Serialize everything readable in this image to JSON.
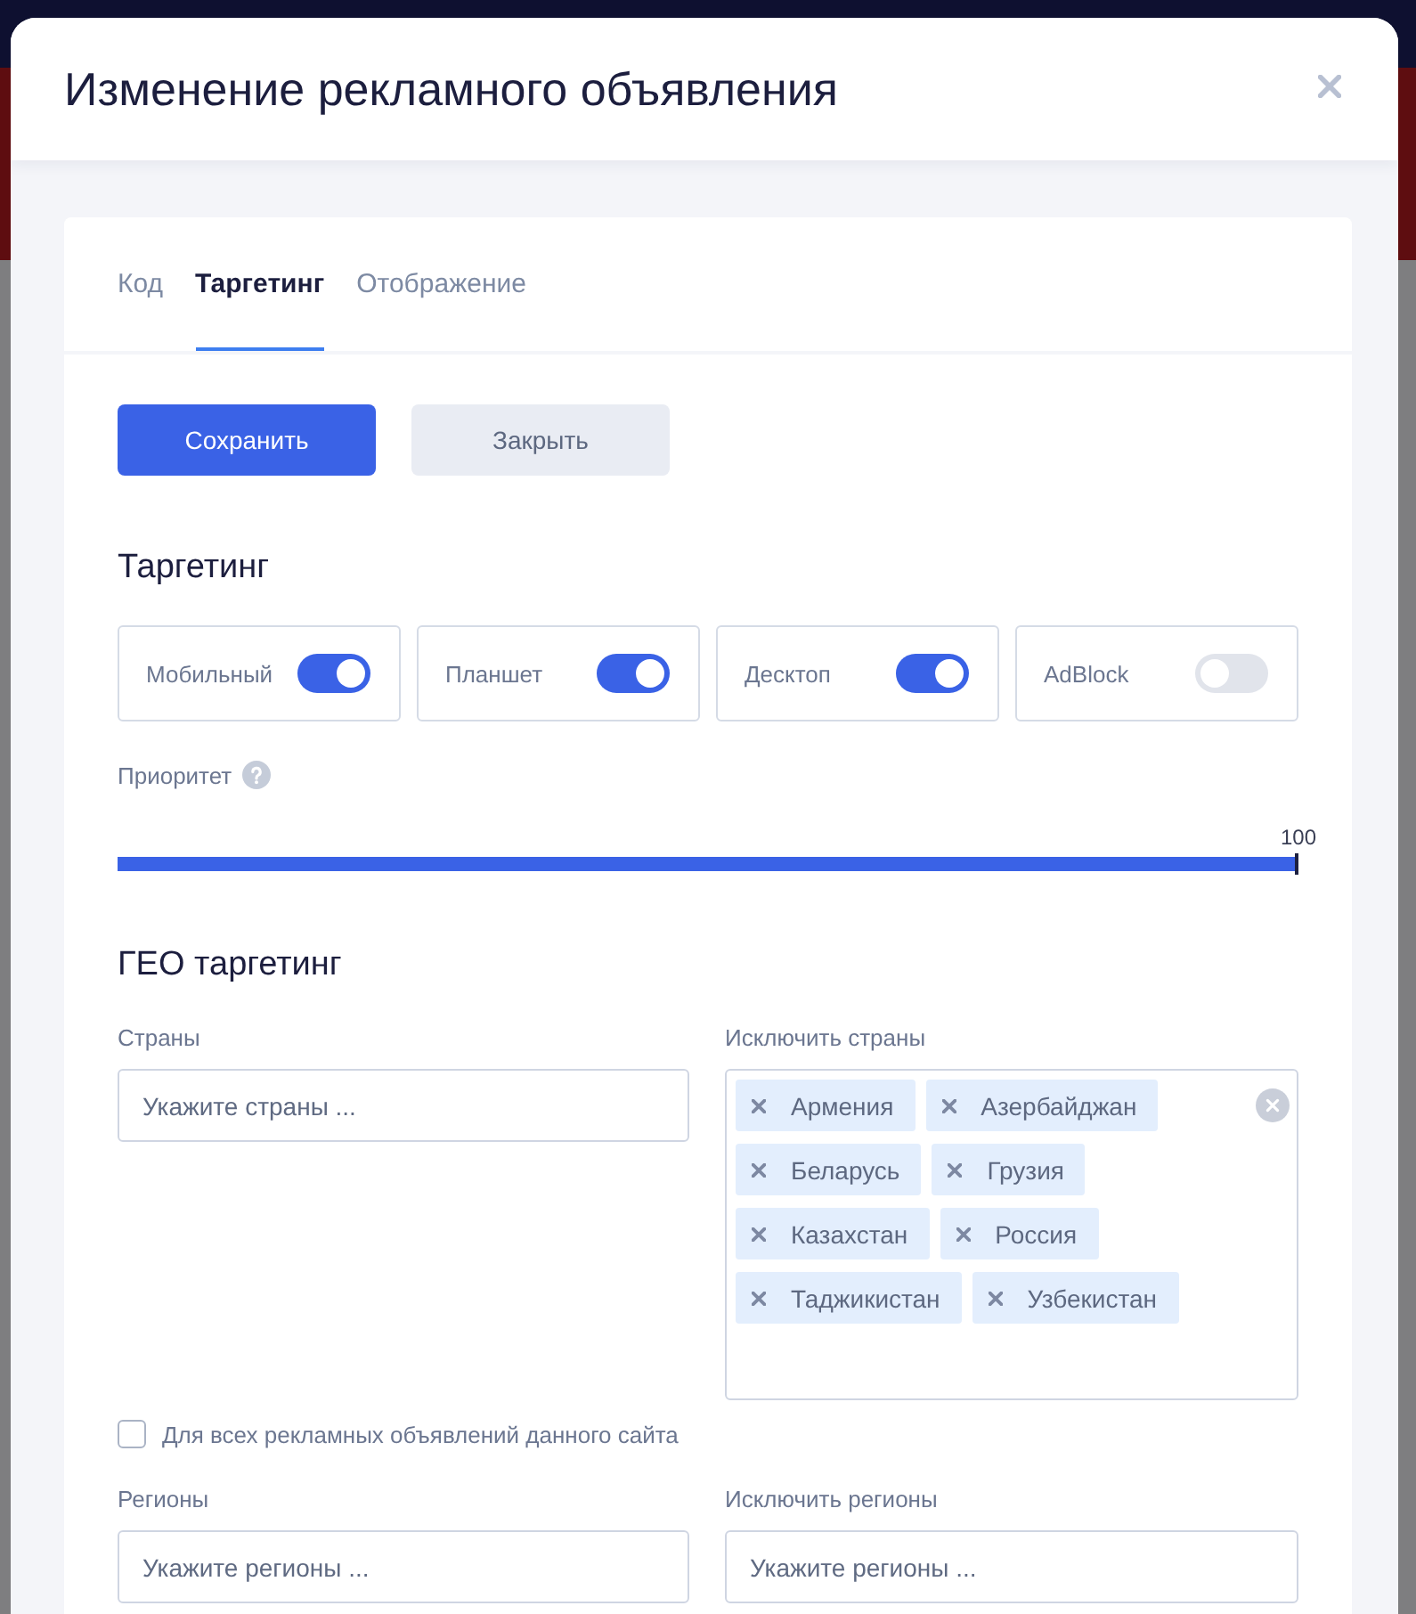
{
  "dialog": {
    "title": "Изменение рекламного объявления"
  },
  "tabs": [
    {
      "label": "Код",
      "selected": false
    },
    {
      "label": "Таргетинг",
      "selected": true
    },
    {
      "label": "Отображение",
      "selected": false
    }
  ],
  "buttons": [
    {
      "label": "Сохранить",
      "kind": "primary"
    },
    {
      "label": "Закрыть",
      "kind": "secondary"
    }
  ],
  "targeting": {
    "heading": "Таргетинг",
    "devices": [
      {
        "label": "Мобильный",
        "on": true
      },
      {
        "label": "Планшет",
        "on": true
      },
      {
        "label": "Десктоп",
        "on": true
      },
      {
        "label": "AdBlock",
        "on": false
      }
    ],
    "priority": {
      "label": "Приоритет",
      "reading": "100",
      "level": 1
    }
  },
  "geo": {
    "heading": "ГЕО таргетинг",
    "countries": {
      "label": "Страны",
      "placeholder": "Укажите страны ..."
    },
    "exclude_countries": {
      "label": "Исключить страны",
      "tags": [
        "Армения",
        "Азербайджан",
        "Беларусь",
        "Грузия",
        "Казахстан",
        "Россия",
        "Таджикистан",
        "Узбекистан"
      ]
    },
    "all_ads": {
      "label": "Для всех рекламных объявлений данного сайта",
      "checked": false
    },
    "regions": {
      "label": "Регионы",
      "placeholder": "Укажите регионы ..."
    },
    "exclude_regions": {
      "label": "Исключить регионы",
      "placeholder": "Укажите регионы ..."
    }
  }
}
